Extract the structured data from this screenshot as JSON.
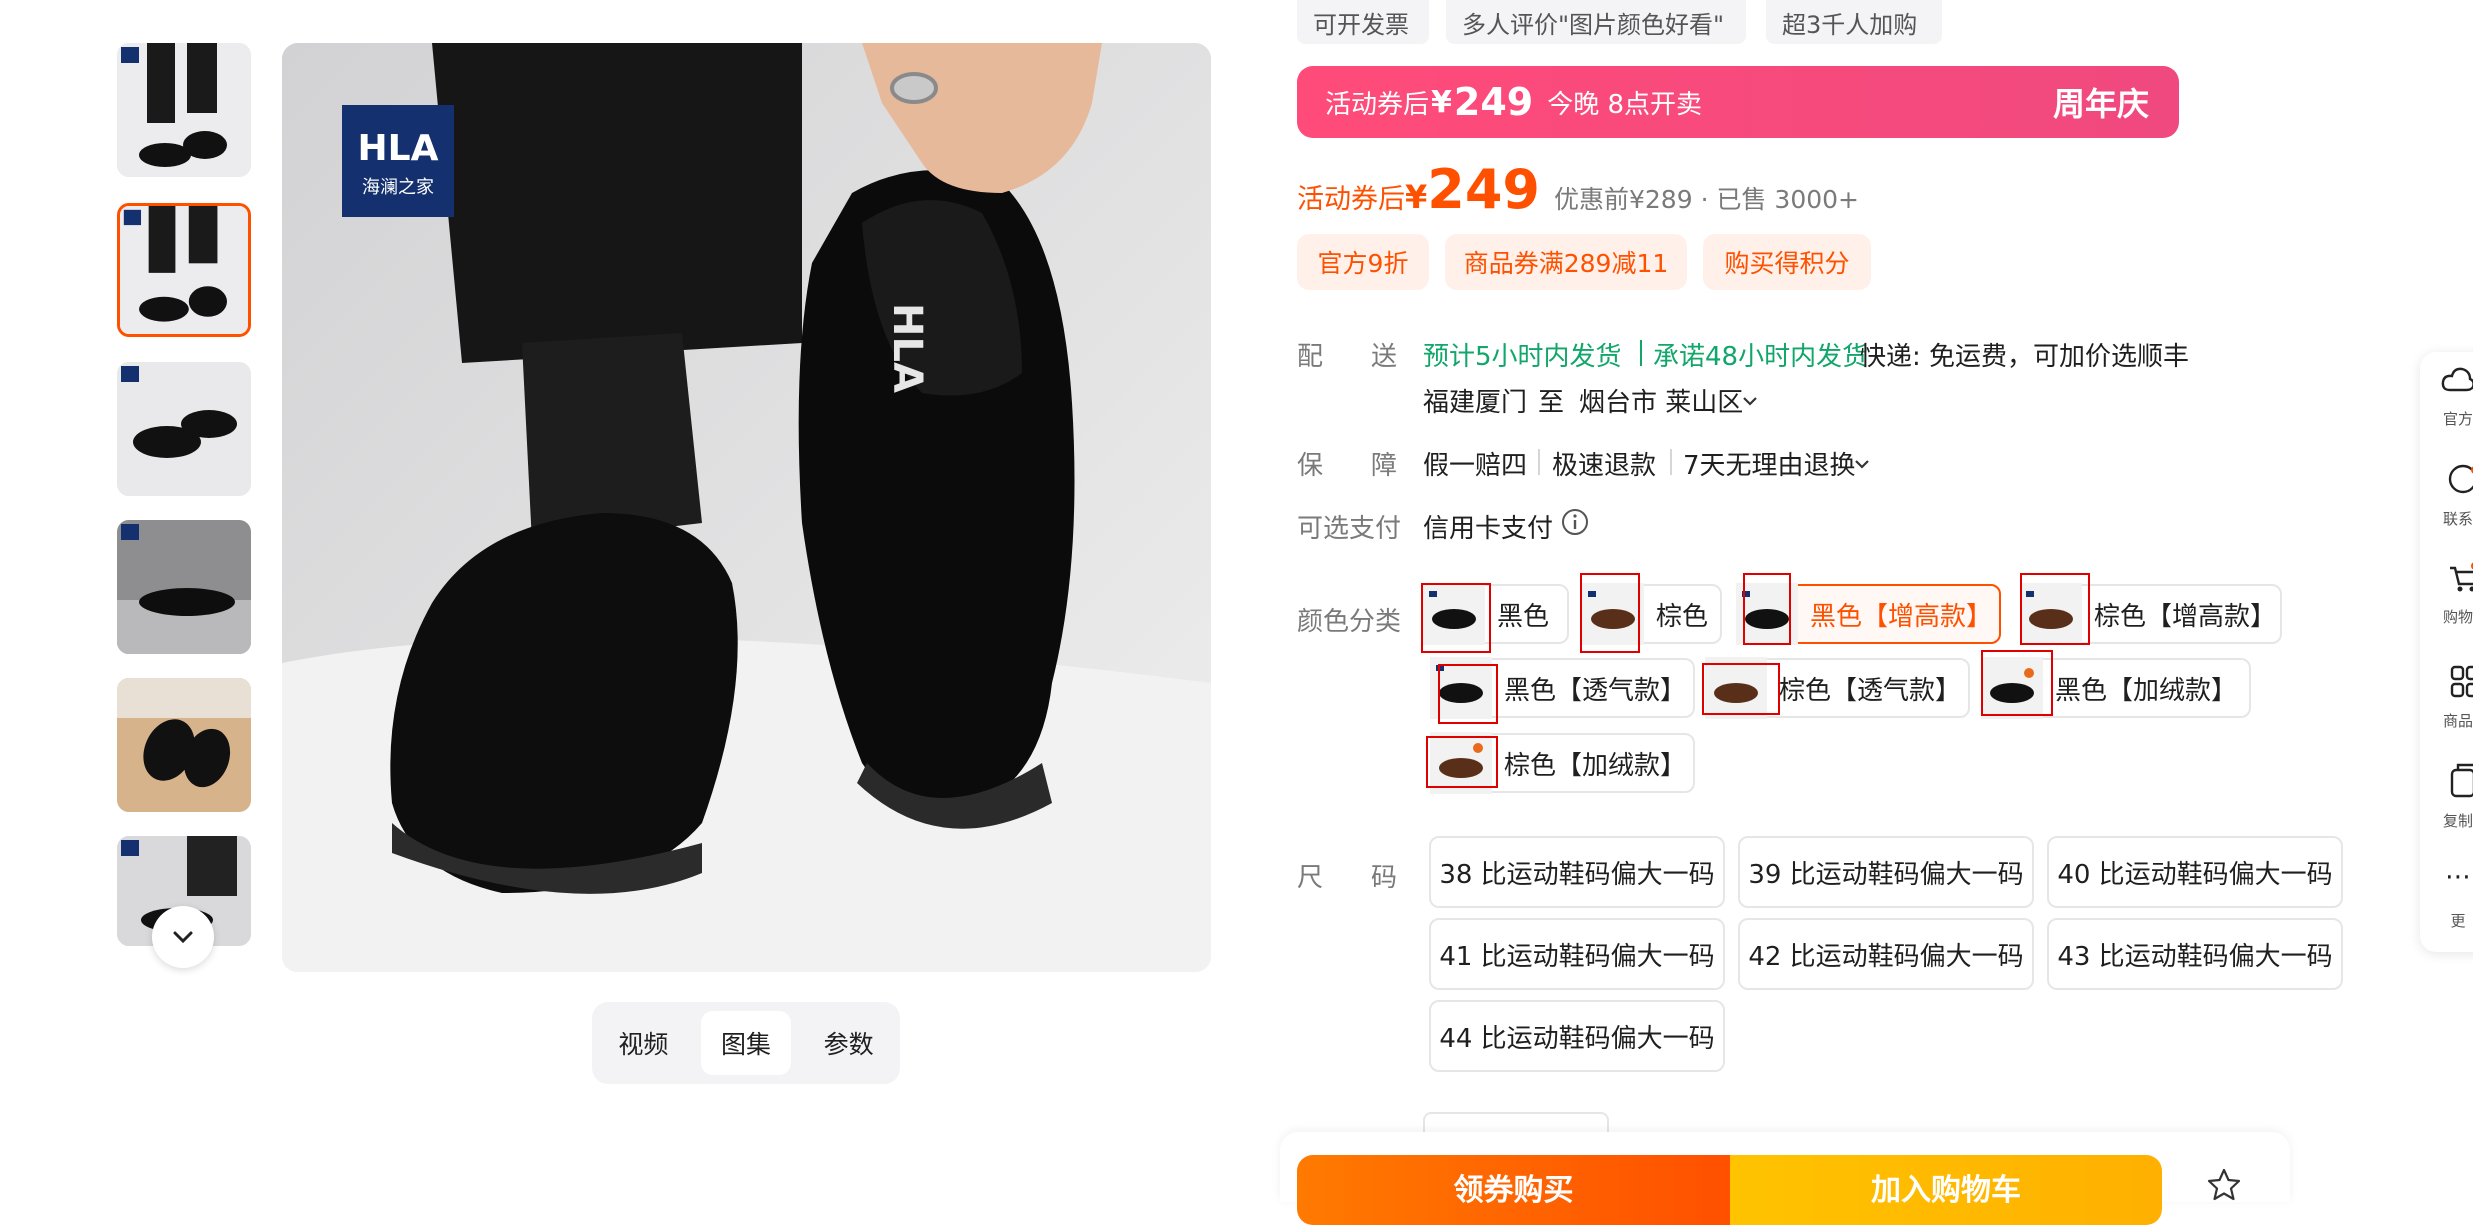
{
  "top_tags": [
    "可开发票",
    "多人评价\"图片颜色好看\"",
    "超3千人加购"
  ],
  "thumbnails": [
    {
      "name": "thumbnail-1",
      "selected": false,
      "logo": "HLA"
    },
    {
      "name": "thumbnail-2",
      "selected": true,
      "logo": "HLA"
    },
    {
      "name": "thumbnail-3",
      "selected": false,
      "logo": "HLA"
    },
    {
      "name": "thumbnail-4",
      "selected": false,
      "logo": "HLA"
    },
    {
      "name": "thumbnail-5",
      "selected": false,
      "logo": ""
    },
    {
      "name": "thumbnail-6",
      "selected": false,
      "logo": "HLA"
    }
  ],
  "main_image": {
    "logo_text": "HLA",
    "logo_sub": "海澜之家",
    "insole_text": "HLA"
  },
  "view_tabs": [
    {
      "label": "视频",
      "active": false
    },
    {
      "label": "图集",
      "active": true
    },
    {
      "label": "参数",
      "active": false
    }
  ],
  "promo_banner": {
    "prefix": "活动券后",
    "currency": "¥",
    "price": "249",
    "time_text": "今晚 8点开卖",
    "event": "周年庆"
  },
  "price": {
    "label": "活动券后",
    "currency": "¥",
    "value": "249",
    "info": "优惠前¥289 · 已售 3000+"
  },
  "chips": [
    "官方9折",
    "商品券满289减11",
    "购买得积分"
  ],
  "delivery": {
    "label_1": "配",
    "label_2": "送",
    "estimate": "预计5小时内发货",
    "promise": "承诺48小时内发货",
    "express": "快递: 免运费，可加价选顺丰",
    "from": "福建厦门",
    "to_word": "至",
    "to": "烟台市 莱山区"
  },
  "guarantee": {
    "label_1": "保",
    "label_2": "障",
    "items": [
      "假一赔四",
      "极速退款",
      "7天无理由退换"
    ]
  },
  "payment": {
    "label": "可选支付",
    "method": "信用卡支付",
    "info_icon": "info-icon"
  },
  "color": {
    "label": "颜色分类",
    "options": [
      {
        "label": "黑色",
        "shoe": "black",
        "selected": false
      },
      {
        "label": "棕色",
        "shoe": "brown",
        "selected": false
      },
      {
        "label": "黑色【增高款】",
        "shoe": "black",
        "selected": true
      },
      {
        "label": "棕色【增高款】",
        "shoe": "brown",
        "selected": false
      },
      {
        "label": "黑色【透气款】",
        "shoe": "black",
        "selected": false
      },
      {
        "label": "棕色【透气款】",
        "shoe": "brown",
        "selected": false
      },
      {
        "label": "黑色【加绒款】",
        "shoe": "black",
        "selected": false
      },
      {
        "label": "棕色【加绒款】",
        "shoe": "brown",
        "selected": false
      }
    ]
  },
  "size": {
    "label_1": "尺",
    "label_2": "码",
    "options": [
      "38 比运动鞋码偏大一码",
      "39 比运动鞋码偏大一码",
      "40 比运动鞋码偏大一码",
      "41 比运动鞋码偏大一码",
      "42 比运动鞋码偏大一码",
      "43 比运动鞋码偏大一码",
      "44 比运动鞋码偏大一码"
    ]
  },
  "actions": {
    "buy": "领券购买",
    "cart": "加入购物车"
  },
  "right_rail": [
    {
      "label": "官方",
      "icon": "cloud-icon"
    },
    {
      "label": "联系",
      "icon": "service-icon"
    },
    {
      "label": "购物",
      "icon": "cart-icon"
    },
    {
      "label": "商品",
      "icon": "grid-icon"
    },
    {
      "label": "复制",
      "icon": "copy-icon"
    },
    {
      "label": "更",
      "icon": "more-icon"
    }
  ],
  "colors": {
    "accent": "#ff5000",
    "promo": "#f0497f",
    "green": "#11a66a",
    "annotation": "#e00000"
  }
}
